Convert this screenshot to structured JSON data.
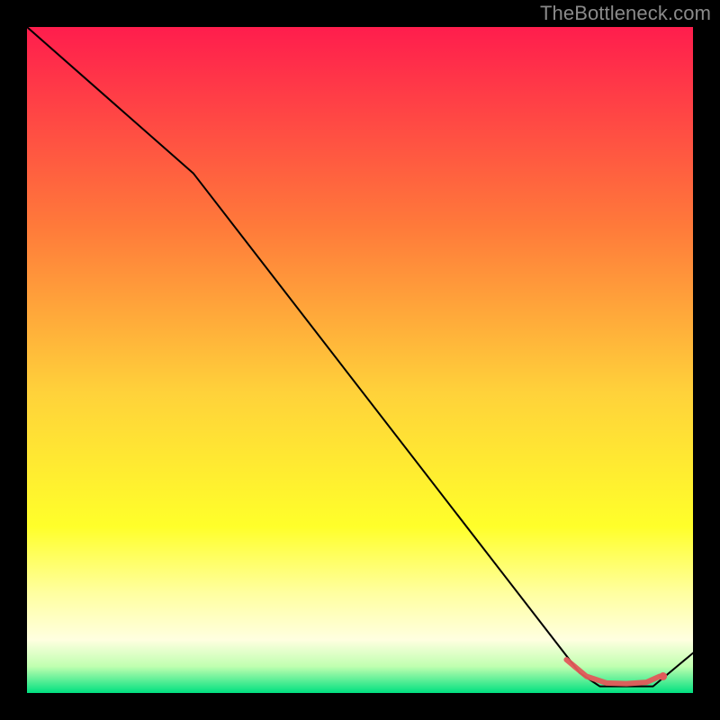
{
  "source_label": "TheBottleneck.com",
  "chart_data": {
    "type": "line",
    "title": "",
    "xlabel": "",
    "ylabel": "",
    "xlim": [
      0,
      100
    ],
    "ylim": [
      0,
      100
    ],
    "background": {
      "type": "vertical-gradient",
      "stops": [
        {
          "offset": 0.0,
          "color": "#ff1d4d"
        },
        {
          "offset": 0.3,
          "color": "#ff7a3a"
        },
        {
          "offset": 0.55,
          "color": "#ffd23a"
        },
        {
          "offset": 0.75,
          "color": "#ffff2a"
        },
        {
          "offset": 0.85,
          "color": "#ffffa0"
        },
        {
          "offset": 0.92,
          "color": "#ffffe0"
        },
        {
          "offset": 0.96,
          "color": "#c0ffb0"
        },
        {
          "offset": 1.0,
          "color": "#00e080"
        }
      ]
    },
    "curve": [
      {
        "x": 0,
        "y": 100
      },
      {
        "x": 25,
        "y": 78
      },
      {
        "x": 83,
        "y": 3
      },
      {
        "x": 86,
        "y": 1
      },
      {
        "x": 94,
        "y": 1
      },
      {
        "x": 100,
        "y": 6
      }
    ],
    "highlight_band": {
      "points": [
        {
          "x": 81,
          "y": 5
        },
        {
          "x": 84,
          "y": 2.5
        },
        {
          "x": 87,
          "y": 1.5
        },
        {
          "x": 90,
          "y": 1.4
        },
        {
          "x": 93,
          "y": 1.6
        },
        {
          "x": 95,
          "y": 2.5
        }
      ],
      "stroke": "#e15a5a",
      "stroke_width": 6
    },
    "marker": {
      "x": 95.5,
      "y": 2.5,
      "r": 4.5,
      "fill": "#e15a5a"
    }
  }
}
